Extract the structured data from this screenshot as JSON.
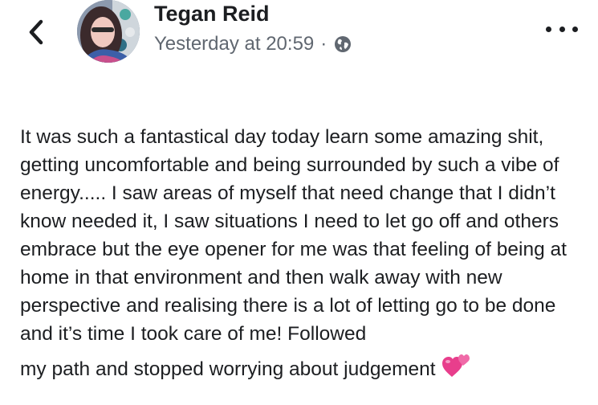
{
  "header": {
    "back_icon": "chevron-left-icon",
    "author_name": "Tegan Reid",
    "timestamp": "Yesterday at 20:59",
    "separator": "·",
    "privacy_icon": "globe-icon",
    "more_icon": "ellipsis-horizontal-icon"
  },
  "post": {
    "text": "It was such a fantastical day today learn some amazing shit, getting uncomfortable and being surrounded by such a vibe of energy..... I saw areas of myself that need change that I didn’t know needed it, I saw situations I need to let go off and others embrace but the eye opener for me was that feeling of being at home in that environment and then walk away with new perspective and realising there is a lot of letting go to be done and it’s time I took care of me! Followed",
    "last_line": "my path and stopped worrying about judgement",
    "emoji": "two-hearts-emoji"
  },
  "colors": {
    "text": "#1c1e21",
    "secondary": "#606770",
    "emoji_pink": "#e83e8c"
  }
}
